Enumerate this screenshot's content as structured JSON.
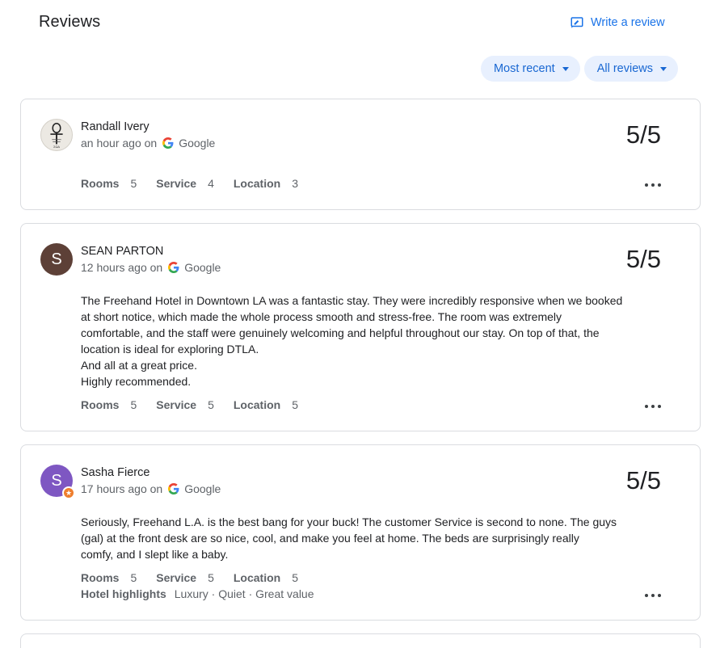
{
  "header": {
    "title": "Reviews",
    "write_review": "Write a review"
  },
  "filters": {
    "sort": "Most recent",
    "scope": "All reviews"
  },
  "colors": {
    "accent": "#1a73e8",
    "chip_bg": "#e8f0fe",
    "avatar_sean": "#5d4037",
    "avatar_sasha": "#7e57c2",
    "badge": "#ee7e2d"
  },
  "labels": {
    "rooms": "Rooms",
    "service": "Service",
    "location": "Location",
    "hotel_highlights": "Hotel highlights"
  },
  "reviews": [
    {
      "name": "Randall Ivery",
      "time": "an hour ago on",
      "source": "Google",
      "score": "5/5",
      "avatar": "image",
      "text": [],
      "rooms": "5",
      "service": "4",
      "location": "3"
    },
    {
      "name": "SEAN PARTON",
      "time": "12 hours ago on",
      "source": "Google",
      "score": "5/5",
      "avatar": "S",
      "text": [
        "The Freehand Hotel in Downtown LA was a fantastic stay. They were incredibly responsive when we booked",
        "at short notice, which made the whole process smooth and stress-free. The room was extremely",
        "comfortable, and the staff were genuinely welcoming and helpful throughout our stay. On top of that, the",
        "location is ideal for exploring DTLA.",
        "And all at a great price.",
        "Highly recommended."
      ],
      "rooms": "5",
      "service": "5",
      "location": "5"
    },
    {
      "name": "Sasha Fierce",
      "time": "17 hours ago on",
      "source": "Google",
      "score": "5/5",
      "avatar": "S",
      "text": [
        "Seriously, Freehand L.A. is the best bang for your buck! The customer Service is second to none. The guys",
        "(gal) at the front desk are so nice, cool, and make you feel at home. The beds are surprisingly really",
        "comfy, and I slept like a baby."
      ],
      "rooms": "5",
      "service": "5",
      "location": "5",
      "highlights": "Luxury · Quiet · Great value"
    }
  ]
}
